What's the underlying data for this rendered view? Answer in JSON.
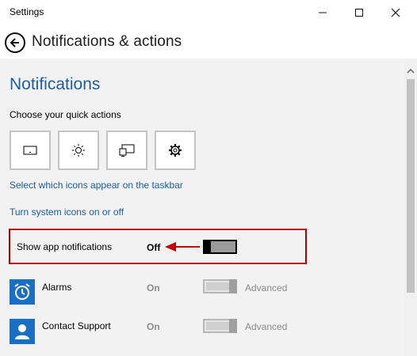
{
  "window": {
    "title": "Settings"
  },
  "header": {
    "title": "Notifications & actions"
  },
  "notifications": {
    "section_title": "Notifications",
    "quick_actions_label": "Choose your quick actions",
    "quick_actions": [
      {
        "icon": "tablet-mode-icon"
      },
      {
        "icon": "brightness-icon"
      },
      {
        "icon": "project-icon"
      },
      {
        "icon": "settings-gear-icon"
      }
    ],
    "link_taskbar_icons": "Select which icons appear on the taskbar",
    "link_system_icons": "Turn system icons on or off",
    "show_app_notifications": {
      "label": "Show app notifications",
      "state": "Off",
      "toggle_on": false
    },
    "apps": [
      {
        "name": "Alarms",
        "state": "On",
        "advanced": "Advanced",
        "icon": "alarm-clock-icon"
      },
      {
        "name": "Contact Support",
        "state": "On",
        "advanced": "Advanced",
        "icon": "person-icon"
      }
    ]
  },
  "colors": {
    "accent": "#1f5fa1",
    "link": "#1d5a9e",
    "highlight_border": "#b40000",
    "annotation_arrow": "#c00000",
    "app_icon_bg": "#1a6fc4",
    "content_bg": "#f2f2f2"
  }
}
